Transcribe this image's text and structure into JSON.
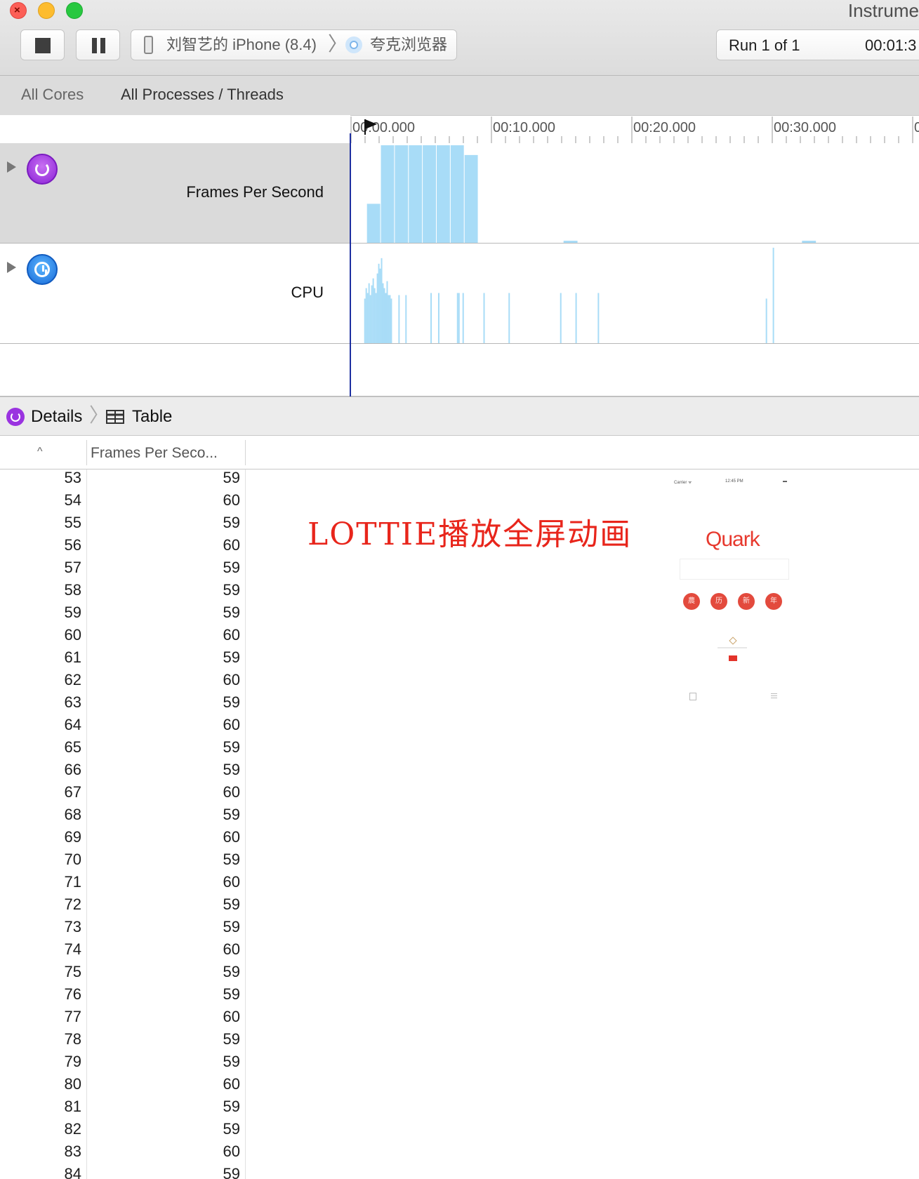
{
  "window": {
    "app_title": "Instrume",
    "device_label": "刘智艺的 iPhone (8.4)",
    "separator": "〉",
    "target_app_label": "夸克浏览器",
    "run_label": "Run 1 of 1",
    "run_time": "00:01:3"
  },
  "strategy_bar": {
    "cores_label": "All Cores",
    "processes_label": "All Processes / Threads"
  },
  "timeline": {
    "ruler_labels": [
      "00:00.000",
      "00:10.000",
      "00:20.000",
      "00:30.000",
      "0"
    ],
    "tracks": [
      {
        "label": "Frames Per Second",
        "icon": "fps-gauge-icon"
      },
      {
        "label": "CPU",
        "icon": "cpu-gauge-icon"
      }
    ],
    "fps_bar_heights": [
      0.4,
      1.0,
      1.0,
      1.0,
      1.0,
      1.0,
      1.0,
      0.9
    ],
    "bar_color": "#a8dcf7",
    "playhead_color": "#1d2fa0"
  },
  "details": {
    "details_label": "Details",
    "separator": "〉",
    "table_label": "Table"
  },
  "table": {
    "sort_indicator": "^",
    "column_title": "Frames Per Seco...",
    "rows": [
      {
        "idx": "53",
        "fps": "59"
      },
      {
        "idx": "54",
        "fps": "60"
      },
      {
        "idx": "55",
        "fps": "59"
      },
      {
        "idx": "56",
        "fps": "60"
      },
      {
        "idx": "57",
        "fps": "59"
      },
      {
        "idx": "58",
        "fps": "59"
      },
      {
        "idx": "59",
        "fps": "59"
      },
      {
        "idx": "60",
        "fps": "60"
      },
      {
        "idx": "61",
        "fps": "59"
      },
      {
        "idx": "62",
        "fps": "60"
      },
      {
        "idx": "63",
        "fps": "59"
      },
      {
        "idx": "64",
        "fps": "60"
      },
      {
        "idx": "65",
        "fps": "59"
      },
      {
        "idx": "66",
        "fps": "59"
      },
      {
        "idx": "67",
        "fps": "60"
      },
      {
        "idx": "68",
        "fps": "59"
      },
      {
        "idx": "69",
        "fps": "60"
      },
      {
        "idx": "70",
        "fps": "59"
      },
      {
        "idx": "71",
        "fps": "60"
      },
      {
        "idx": "72",
        "fps": "59"
      },
      {
        "idx": "73",
        "fps": "59"
      },
      {
        "idx": "74",
        "fps": "60"
      },
      {
        "idx": "75",
        "fps": "59"
      },
      {
        "idx": "76",
        "fps": "59"
      },
      {
        "idx": "77",
        "fps": "60"
      },
      {
        "idx": "78",
        "fps": "59"
      },
      {
        "idx": "79",
        "fps": "59"
      },
      {
        "idx": "80",
        "fps": "60"
      },
      {
        "idx": "81",
        "fps": "59"
      },
      {
        "idx": "82",
        "fps": "59"
      },
      {
        "idx": "83",
        "fps": "60"
      },
      {
        "idx": "84",
        "fps": "59"
      }
    ]
  },
  "annotation": {
    "text": "LOTTIE播放全屏动画",
    "color": "#e8251b"
  },
  "phone_screenshot": {
    "logo": "Quark",
    "buttons": [
      "農",
      "历",
      "新",
      "年"
    ]
  }
}
